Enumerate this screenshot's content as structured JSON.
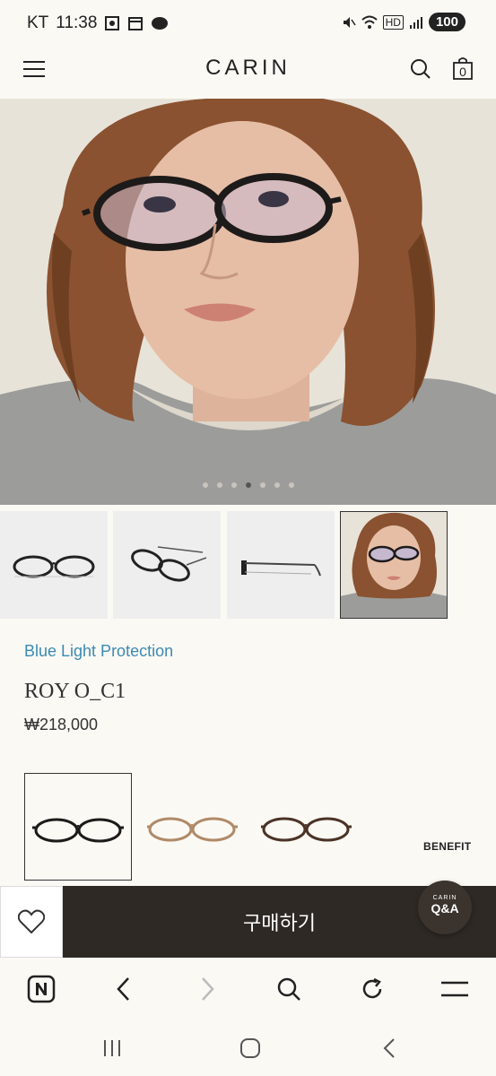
{
  "status_bar": {
    "carrier": "KT",
    "time": "11:38",
    "battery": "100",
    "network": "HD"
  },
  "header": {
    "logo": "CARIN"
  },
  "cart": {
    "count": "0"
  },
  "hero": {
    "dot_count": 7,
    "active_dot": 3
  },
  "product": {
    "tag": "Blue Light Protection",
    "name": "ROY O_C1",
    "price": "₩218,000"
  },
  "variants": {
    "benefit_label": "BENEFIT"
  },
  "buy_bar": {
    "buy_label": "구매하기"
  },
  "qa_button": {
    "brand": "CARIN",
    "label": "Q&A"
  },
  "colors": {
    "accent_blue": "#3b8ab3",
    "buy_button": "#2f2925",
    "background": "#fbf9f4"
  }
}
